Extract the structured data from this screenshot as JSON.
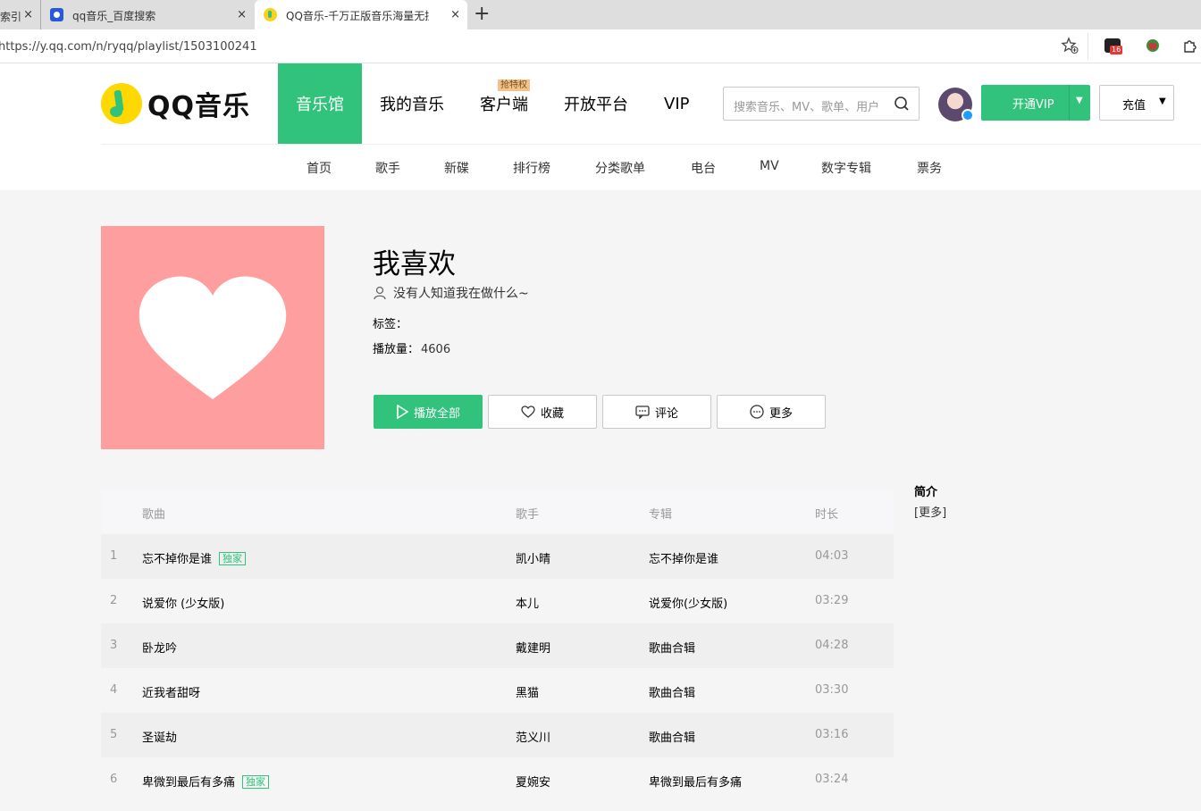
{
  "browser": {
    "tabs": [
      {
        "title": "索引",
        "close": "×"
      },
      {
        "title": "qq音乐_百度搜索",
        "close": "×"
      },
      {
        "title": "QQ音乐-千万正版音乐海量无损曲",
        "close": "×"
      }
    ],
    "new_tab": "+",
    "url": "https://y.qq.com/n/ryqq/playlist/1503100241",
    "ext_badge": "16"
  },
  "site": {
    "logo_text": "QQ音乐",
    "nav": [
      {
        "label": "音乐馆",
        "active": true
      },
      {
        "label": "我的音乐"
      },
      {
        "label": "客户端",
        "tip": "抢特权"
      },
      {
        "label": "开放平台"
      },
      {
        "label": "VIP"
      }
    ],
    "search_placeholder": "搜索音乐、MV、歌单、用户",
    "vip_button": "开通VIP",
    "charge_button": "充值",
    "subnav": [
      "首页",
      "歌手",
      "新碟",
      "排行榜",
      "分类歌单",
      "电台",
      "MV",
      "数字专辑",
      "票务"
    ]
  },
  "playlist": {
    "title": "我喜欢",
    "creator": "没有人知道我在做什么~",
    "tags_label": "标签：",
    "plays_label": "播放量：",
    "plays_value": "4606",
    "cover_color": "#ff9e9e",
    "buttons": {
      "play_all": "播放全部",
      "collect": "收藏",
      "comment": "评论",
      "more": "更多"
    }
  },
  "table": {
    "headers": {
      "song": "歌曲",
      "singer": "歌手",
      "album": "专辑",
      "duration": "时长"
    },
    "rows": [
      {
        "no": "1",
        "song": "忘不掉你是谁",
        "exclusive": "独家",
        "singer": "凯小晴",
        "album": "忘不掉你是谁",
        "duration": "04:03"
      },
      {
        "no": "2",
        "song": "说爱你 (少女版)",
        "exclusive": "",
        "singer": "本儿",
        "album": "说爱你(少女版)",
        "duration": "03:29"
      },
      {
        "no": "3",
        "song": "卧龙吟",
        "exclusive": "",
        "singer": "戴建明",
        "album": "歌曲合辑",
        "duration": "04:28"
      },
      {
        "no": "4",
        "song": "近我者甜呀",
        "exclusive": "",
        "singer": "黑猫",
        "album": "歌曲合辑",
        "duration": "03:30"
      },
      {
        "no": "5",
        "song": "圣诞劫",
        "exclusive": "",
        "singer": "范义川",
        "album": "歌曲合辑",
        "duration": "03:16"
      },
      {
        "no": "6",
        "song": "卑微到最后有多痛",
        "exclusive": "独家",
        "singer": "夏婉安",
        "album": "卑微到最后有多痛",
        "duration": "03:24"
      }
    ]
  },
  "intro": {
    "heading": "简介",
    "more": "[更多]"
  },
  "colors": {
    "accent": "#31c27c",
    "logo_yellow": "#ffd800"
  }
}
